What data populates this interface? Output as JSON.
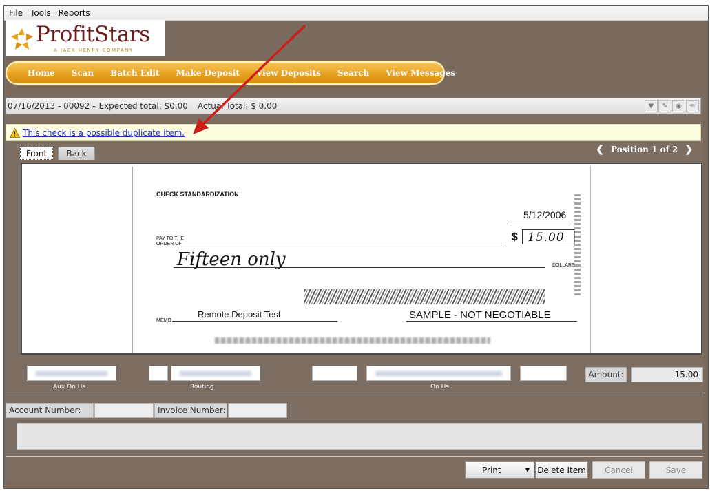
{
  "menu": [
    "File",
    "Tools",
    "Reports"
  ],
  "logo": {
    "brand": "ProfitStars",
    "tagline": "A JACK HENRY COMPANY"
  },
  "nav": [
    "Home",
    "Scan",
    "Batch Edit",
    "Make Deposit",
    "View Deposits",
    "Search",
    "View Messages"
  ],
  "batch": {
    "id": "07/16/2013 - 00092 -",
    "expected": "Expected total: $0.00",
    "actual": "Actual Total: $ 0.00"
  },
  "warning": {
    "text": "This check is a possible duplicate item."
  },
  "tabs": {
    "front": "Front",
    "back": "Back"
  },
  "position": {
    "label": "Position 1 of 2"
  },
  "check": {
    "title": "CHECK STANDARDIZATION",
    "date": "5/12/2006",
    "pay_to": "PAY TO THE\nORDER OF",
    "amount_box": "15.00",
    "amount_words": "Fifteen  only",
    "dollars": "DOLLARS",
    "memo_label": "MEMO",
    "memo": "Remote Deposit Test",
    "stamp": "SAMPLE - NOT NEGOTIABLE"
  },
  "fields": {
    "aux_on_us": "Aux On Us",
    "routing": "Routing",
    "on_us": "On Us",
    "amount_label": "Amount:",
    "amount_value": "15.00"
  },
  "form": {
    "account_label": "Account Number:",
    "invoice_label": "Invoice Number:"
  },
  "buttons": {
    "print": "Print",
    "delete": "Delete Item",
    "cancel": "Cancel",
    "save": "Save"
  },
  "colors": {
    "nav_gold": "#e6a01f",
    "panel_brown": "#7d6e63",
    "warning_bg": "#fffde0",
    "annotation_arrow": "#cc1f1a"
  }
}
